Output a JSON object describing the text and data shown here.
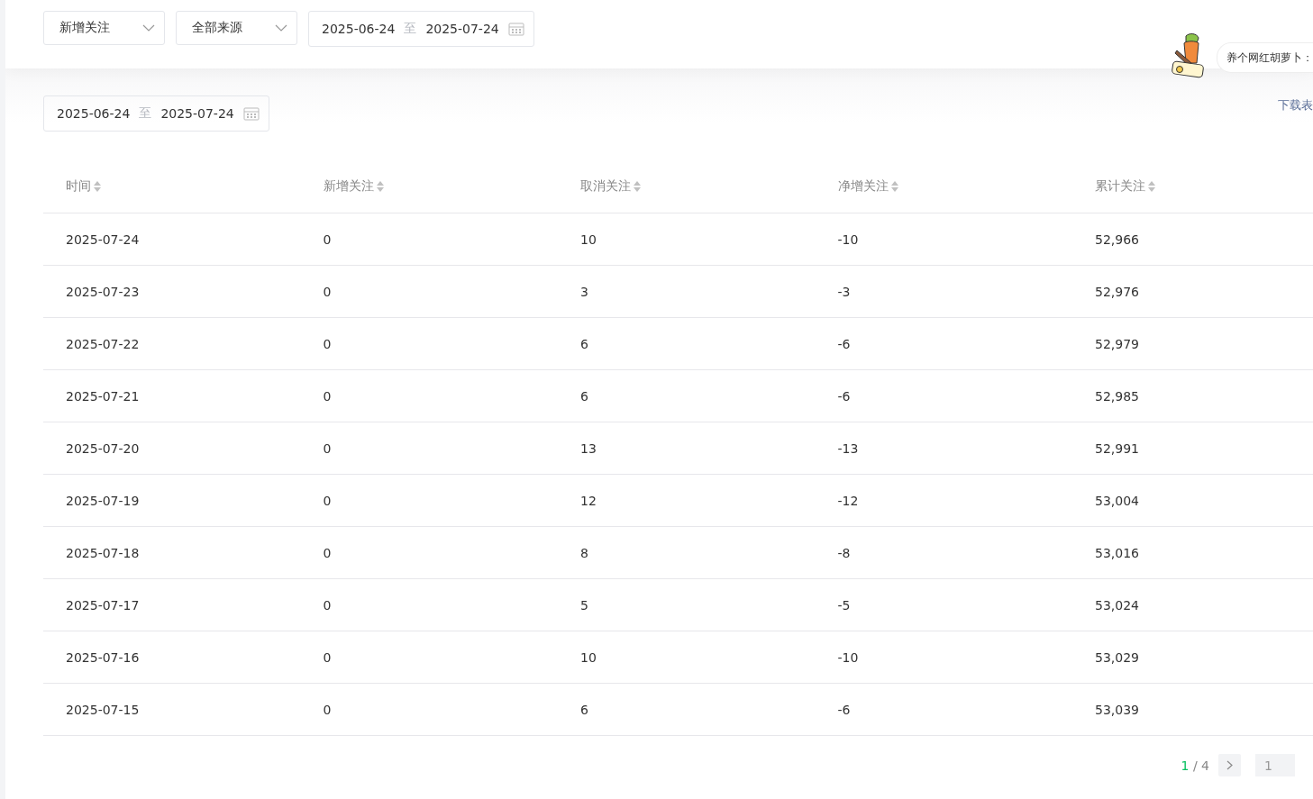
{
  "filters": {
    "metric": "新增关注",
    "source": "全部来源",
    "date_range": {
      "start": "2025-06-24",
      "separator": "至",
      "end": "2025-07-24"
    }
  },
  "promo": {
    "text": "养个网红胡萝卜："
  },
  "date_range": {
    "start": "2025-06-24",
    "separator": "至",
    "end": "2025-07-24"
  },
  "download_link": "下载表",
  "table": {
    "columns": [
      "时间",
      "新增关注",
      "取消关注",
      "净增关注",
      "累计关注"
    ],
    "rows": [
      [
        "2025-07-24",
        "0",
        "10",
        "-10",
        "52,966"
      ],
      [
        "2025-07-23",
        "0",
        "3",
        "-3",
        "52,976"
      ],
      [
        "2025-07-22",
        "0",
        "6",
        "-6",
        "52,979"
      ],
      [
        "2025-07-21",
        "0",
        "6",
        "-6",
        "52,985"
      ],
      [
        "2025-07-20",
        "0",
        "13",
        "-13",
        "52,991"
      ],
      [
        "2025-07-19",
        "0",
        "12",
        "-12",
        "53,004"
      ],
      [
        "2025-07-18",
        "0",
        "8",
        "-8",
        "53,016"
      ],
      [
        "2025-07-17",
        "0",
        "5",
        "-5",
        "53,024"
      ],
      [
        "2025-07-16",
        "0",
        "10",
        "-10",
        "53,029"
      ],
      [
        "2025-07-15",
        "0",
        "6",
        "-6",
        "53,039"
      ]
    ]
  },
  "pagination": {
    "current": "1",
    "total": "/ 4",
    "jump_value": "1"
  }
}
